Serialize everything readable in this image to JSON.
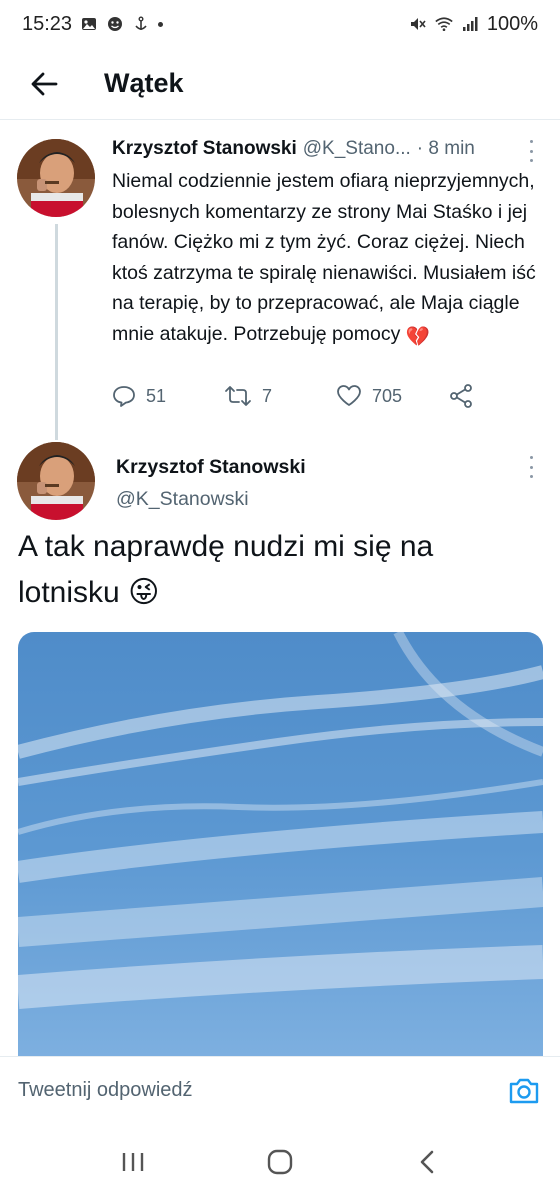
{
  "status_bar": {
    "time": "15:23",
    "battery": "100%"
  },
  "header": {
    "title": "Wątek"
  },
  "parent_tweet": {
    "name": "Krzysztof Stanowski",
    "handle": "@K_Stano...",
    "time": "· 8 min",
    "text": "Niemal codziennie jestem ofiarą nieprzyjemnych, bolesnych komentarzy ze strony Mai Staśko i jej fanów. Ciężko mi z tym żyć. Coraz ciężej. Niech ktoś zatrzyma te spiralę nienawiści. Musiałem iść na terapię, by to przepracować, ale Maja ciągle mnie atakuje. Potrzebuję pomocy",
    "emoji": "💔",
    "replies": "51",
    "retweets": "7",
    "likes": "705"
  },
  "main_tweet": {
    "name": "Krzysztof Stanowski",
    "handle": "@K_Stanowski",
    "text": "A tak naprawdę nudzi mi się na lotnisku",
    "emoji": "😜"
  },
  "reply_bar": {
    "placeholder": "Tweetnij odpowiedź"
  },
  "colors": {
    "accent": "#1d9bf0",
    "text_primary": "#0f1419",
    "text_secondary": "#536471",
    "divider": "#e6ecf0",
    "heart_emoji": "#d81b3c"
  },
  "icons": {
    "back": "arrow-left-icon",
    "reply": "reply-bubble-icon",
    "retweet": "retweet-icon",
    "like": "heart-icon",
    "share": "share-icon",
    "more": "more-vertical-icon",
    "camera": "camera-icon",
    "nav_recents": "recents-icon",
    "nav_home": "home-icon",
    "nav_back": "nav-back-icon"
  }
}
